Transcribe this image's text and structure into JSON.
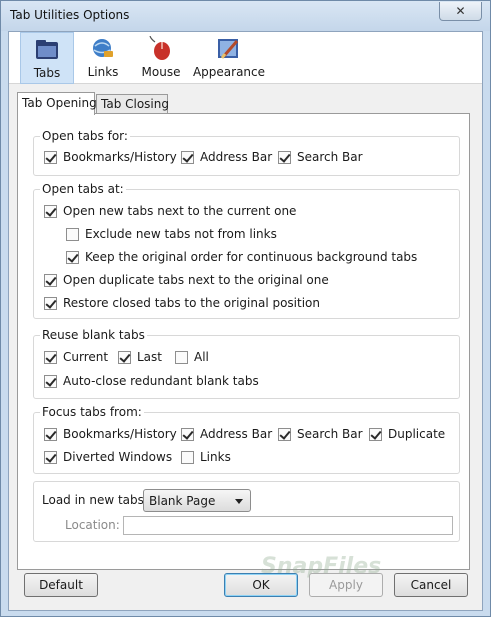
{
  "window": {
    "title": "Tab Utilities Options",
    "close_glyph": "✕"
  },
  "toolbar": {
    "items": [
      {
        "label": "Tabs",
        "icon": "folder-icon",
        "active": true
      },
      {
        "label": "Links",
        "icon": "globe-link-icon",
        "active": false
      },
      {
        "label": "Mouse",
        "icon": "mouse-icon",
        "active": false
      },
      {
        "label": "Appearance",
        "icon": "paint-icon",
        "active": false
      }
    ]
  },
  "subtabs": [
    {
      "label": "Tab Opening",
      "selected": true
    },
    {
      "label": "Tab Closing",
      "selected": false
    }
  ],
  "groups": {
    "open_tabs_for": {
      "title": "Open tabs for:",
      "options": [
        {
          "label": "Bookmarks/History",
          "checked": true
        },
        {
          "label": "Address Bar",
          "checked": true
        },
        {
          "label": "Search Bar",
          "checked": true
        }
      ]
    },
    "open_tabs_at": {
      "title": "Open tabs at:",
      "options": [
        {
          "label": "Open new tabs next to the current one",
          "checked": true
        },
        {
          "label": "Exclude new tabs not from links",
          "checked": false
        },
        {
          "label": "Keep the original order for continuous background tabs",
          "checked": true
        },
        {
          "label": "Open duplicate tabs next to the original one",
          "checked": true
        },
        {
          "label": "Restore closed tabs to the original position",
          "checked": true
        }
      ]
    },
    "reuse_blank_tabs": {
      "title": "Reuse blank tabs",
      "options": [
        {
          "label": "Current",
          "checked": true
        },
        {
          "label": "Last",
          "checked": true
        },
        {
          "label": "All",
          "checked": false
        },
        {
          "label": "Auto-close redundant blank tabs",
          "checked": true
        }
      ]
    },
    "focus_tabs_from": {
      "title": "Focus tabs from:",
      "options": [
        {
          "label": "Bookmarks/History",
          "checked": true
        },
        {
          "label": "Address Bar",
          "checked": true
        },
        {
          "label": "Search Bar",
          "checked": true
        },
        {
          "label": "Duplicate",
          "checked": true
        },
        {
          "label": "Diverted Windows",
          "checked": true
        },
        {
          "label": "Links",
          "checked": false
        }
      ]
    },
    "load": {
      "label": "Load in new tabs:",
      "selected_value": "Blank Page",
      "location_label": "Location:",
      "location_value": ""
    }
  },
  "buttons": {
    "default": "Default",
    "ok": "OK",
    "apply": "Apply",
    "cancel": "Cancel"
  },
  "watermark": "SnapFiles",
  "colors": {
    "accent": "#cfe3f7",
    "frame": "#c9dbee"
  }
}
